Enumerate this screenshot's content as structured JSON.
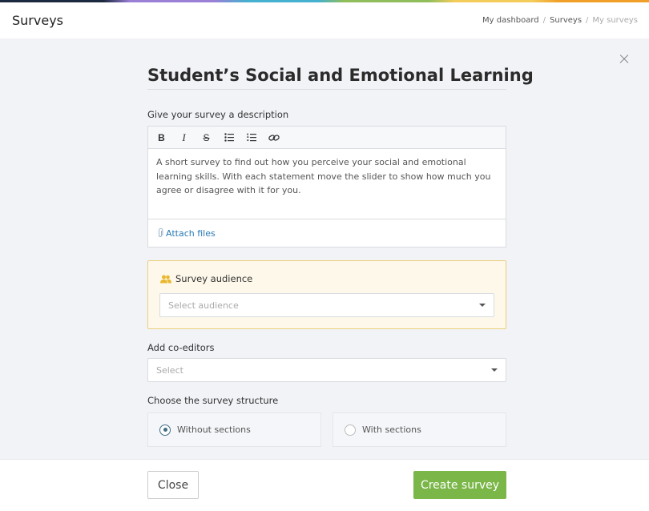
{
  "header": {
    "title": "Surveys",
    "breadcrumb": [
      "My dashboard",
      "Surveys",
      "My surveys"
    ],
    "breadcrumb_separator": "/"
  },
  "accent_colors": {
    "primary_button": "#7ab648",
    "link": "#2a7ab5",
    "audience_highlight_bg": "#fdf8ea",
    "audience_highlight_border": "#e8cf7a",
    "audience_icon": "#e8b830"
  },
  "form": {
    "survey_title": "Student’s Social and Emotional Learning",
    "description_label": "Give your survey a description",
    "toolbar": {
      "bold": "B",
      "italic": "I",
      "strikethrough": "S",
      "icons": [
        "bold-icon",
        "italic-icon",
        "strikethrough-icon",
        "bullet-list-icon",
        "numbered-list-icon",
        "link-icon"
      ]
    },
    "description_text": "A short survey to find out how you perceive your social and emotional learning skills. With each statement move the slider to show how much you agree or disagree with it for you.",
    "attach_files": "Attach files",
    "audience": {
      "label": "Survey audience",
      "placeholder": "Select audience"
    },
    "coeditors": {
      "label": "Add co-editors",
      "placeholder": "Select"
    },
    "structure": {
      "label": "Choose the survey structure",
      "options": [
        {
          "label": "Without sections",
          "selected": true
        },
        {
          "label": "With sections",
          "selected": false
        }
      ]
    }
  },
  "footer": {
    "close_label": "Close",
    "create_label": "Create survey"
  }
}
